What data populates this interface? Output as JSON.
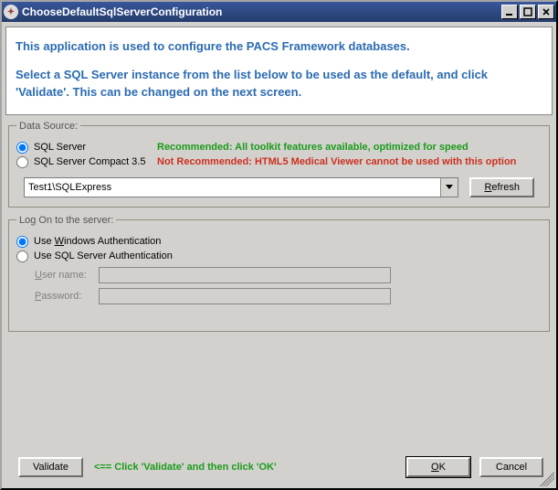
{
  "window": {
    "title": "ChooseDefaultSqlServerConfiguration"
  },
  "intro": {
    "line1": "This application is used to configure the PACS Framework databases.",
    "line2": "Select a SQL Server instance from the list below to be used as the default, and click 'Validate'.  This can be changed on the next screen."
  },
  "dataSource": {
    "legend": "Data Source:",
    "option1_label": "SQL Server",
    "option1_note": "Recommended: All toolkit features available, optimized for speed",
    "option2_label": "SQL Server Compact 3.5",
    "option2_note": "Not Recommended:  HTML5 Medical Viewer cannot be used with this option",
    "instance_value": "Test1\\SQLExpress",
    "refresh_label_pre": "",
    "refresh_label": "Refresh",
    "refresh_u": "R",
    "refresh_rest": "efresh"
  },
  "logon": {
    "legend": "Log On to the server:",
    "useWindows_pre": "Use ",
    "useWindows_u": "W",
    "useWindows_rest": "indows Authentication",
    "useSql_label": "Use SQL Server Authentication",
    "user_pre": "",
    "user_u": "U",
    "user_rest": "ser name:",
    "pass_u": "P",
    "pass_rest": "assword:",
    "username_value": "",
    "password_value": ""
  },
  "buttons": {
    "validate": "Validate",
    "hint": "<== Click 'Validate' and then click 'OK'",
    "ok_u": "O",
    "ok_rest": "K",
    "cancel": "Cancel"
  }
}
